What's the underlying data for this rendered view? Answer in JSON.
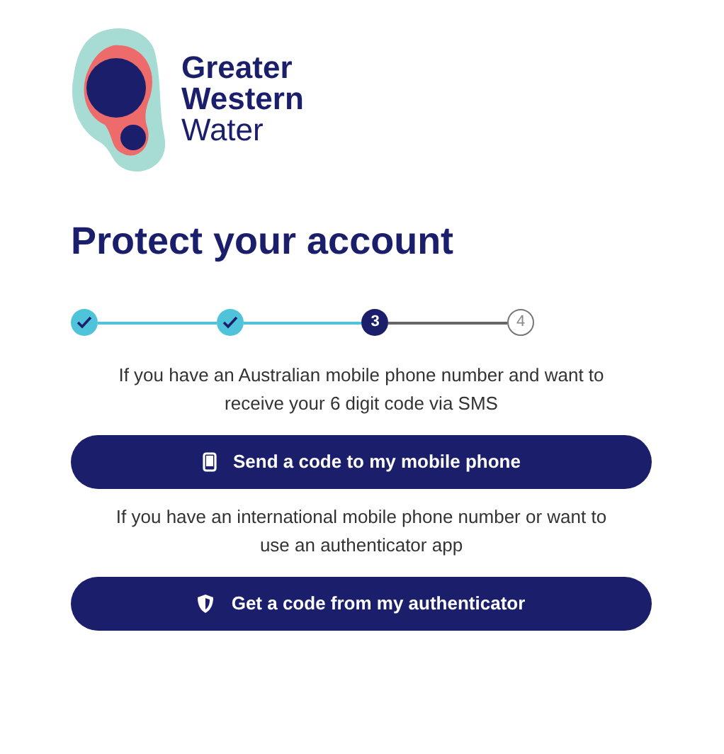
{
  "logo": {
    "lines": [
      "Greater",
      "Western",
      "Water"
    ]
  },
  "heading": "Protect your account",
  "steps": [
    {
      "kind": "done"
    },
    {
      "kind": "done"
    },
    {
      "kind": "current",
      "label": "3"
    },
    {
      "kind": "upcoming",
      "label": "4"
    }
  ],
  "options": [
    {
      "description": "If you have an Australian mobile phone number and want to receive your 6 digit code via SMS",
      "button": "Send a code to my mobile phone",
      "kind": "phone"
    },
    {
      "description": "If you have an international mobile phone number or want to use an authenticator app",
      "button": "Get a code from my authenticator",
      "kind": "shield"
    }
  ]
}
